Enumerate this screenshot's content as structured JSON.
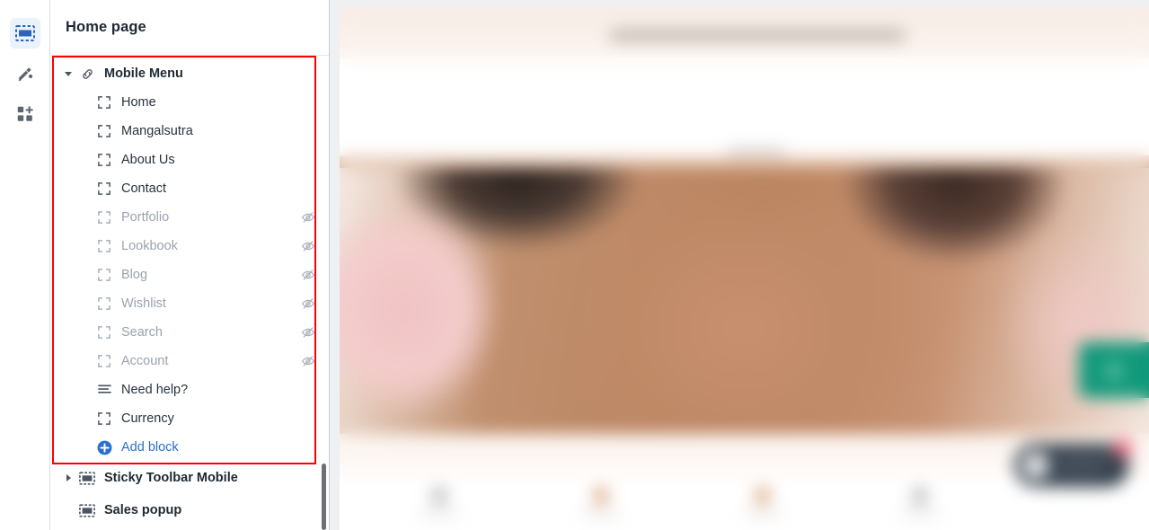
{
  "rail": {
    "items": [
      {
        "icon": "sections-icon",
        "name": "sections-tab",
        "selected": true
      },
      {
        "icon": "paint-roller-icon",
        "name": "theme-settings-tab",
        "selected": false
      },
      {
        "icon": "apps-blocks-icon",
        "name": "apps-tab",
        "selected": false
      }
    ]
  },
  "sidebar": {
    "page_title": "Home page",
    "highlight_color": "#ff0000",
    "accent_color": "#2c6ecb",
    "sections": [
      {
        "label": "Mobile Menu",
        "icon": "link-icon",
        "expanded": true,
        "highlighted": true,
        "blocks": [
          {
            "label": "Home",
            "icon": "block-icon",
            "hidden": false
          },
          {
            "label": "Mangalsutra",
            "icon": "block-icon",
            "hidden": false
          },
          {
            "label": "About Us",
            "icon": "block-icon",
            "hidden": false
          },
          {
            "label": "Contact",
            "icon": "block-icon",
            "hidden": false
          },
          {
            "label": "Portfolio",
            "icon": "block-icon",
            "hidden": true
          },
          {
            "label": "Lookbook",
            "icon": "block-icon",
            "hidden": true
          },
          {
            "label": "Blog",
            "icon": "block-icon",
            "hidden": true
          },
          {
            "label": "Wishlist",
            "icon": "block-icon",
            "hidden": true
          },
          {
            "label": "Search",
            "icon": "block-icon",
            "hidden": true
          },
          {
            "label": "Account",
            "icon": "block-icon",
            "hidden": true
          },
          {
            "label": "Need help?",
            "icon": "menu-list-icon",
            "hidden": false
          },
          {
            "label": "Currency",
            "icon": "block-icon",
            "hidden": false
          }
        ],
        "add_block_label": "Add block"
      },
      {
        "label": "Sticky Toolbar Mobile",
        "icon": "section-icon",
        "expanded": false,
        "highlighted": false,
        "blocks": [],
        "add_block_label": ""
      },
      {
        "label": "Sales popup",
        "icon": "section-icon",
        "expanded": false,
        "highlighted": false,
        "blocks": [],
        "add_block_label": ""
      }
    ]
  },
  "preview": {
    "announcement_text": "",
    "hero_alt": "blurred storefront hero banner",
    "whatsapp_button": "",
    "chat_widget_label": "",
    "toolbar_items": [
      "",
      "",
      "",
      ""
    ]
  }
}
